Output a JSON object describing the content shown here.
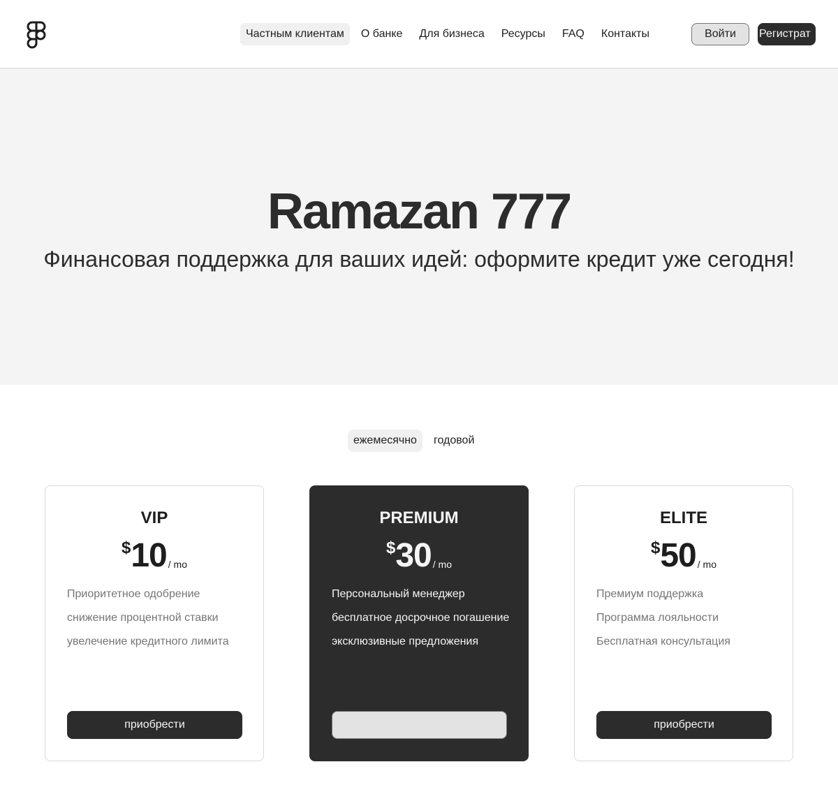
{
  "header": {
    "logo": "figma-logo-icon",
    "nav": [
      {
        "label": "Частным клиентам",
        "active": true
      },
      {
        "label": "О банке"
      },
      {
        "label": "Для бизнеса"
      },
      {
        "label": "Ресурсы"
      },
      {
        "label": "FAQ"
      },
      {
        "label": "Контакты"
      }
    ],
    "login_label": "Войти",
    "register_label": "Регистрат"
  },
  "hero": {
    "title": "Ramazan 777",
    "subtitle": "Финансовая поддержка для ваших идей: оформите кредит уже сегодня!"
  },
  "billing_toggle": {
    "options": [
      "ежемесячно",
      "годовой"
    ],
    "selected": "ежемесячно"
  },
  "plans": [
    {
      "name": "VIP",
      "currency": "$",
      "price": "10",
      "period": "/ mo",
      "features": [
        "Приоритетное одобрение",
        "снижение процентной ставки",
        "увелечение кредитного лимита"
      ],
      "button_label": "приобрести"
    },
    {
      "name": "PREMIUM",
      "currency": "$",
      "price": "30",
      "period": "/ mo",
      "features": [
        "Персональный менеджер",
        "бесплатное досрочное погашение",
        "эксклюзивные предложения"
      ],
      "button_label": ""
    },
    {
      "name": "ELITE",
      "currency": "$",
      "price": "50",
      "period": "/ mo",
      "features": [
        "Премиум поддержка",
        "Программа лояльности",
        "Бесплатная консультация"
      ],
      "button_label": "приобрести"
    }
  ],
  "colors": {
    "primary": "#2c2c2c",
    "hero_bg": "#f4f4f4",
    "muted_text": "#757575"
  }
}
